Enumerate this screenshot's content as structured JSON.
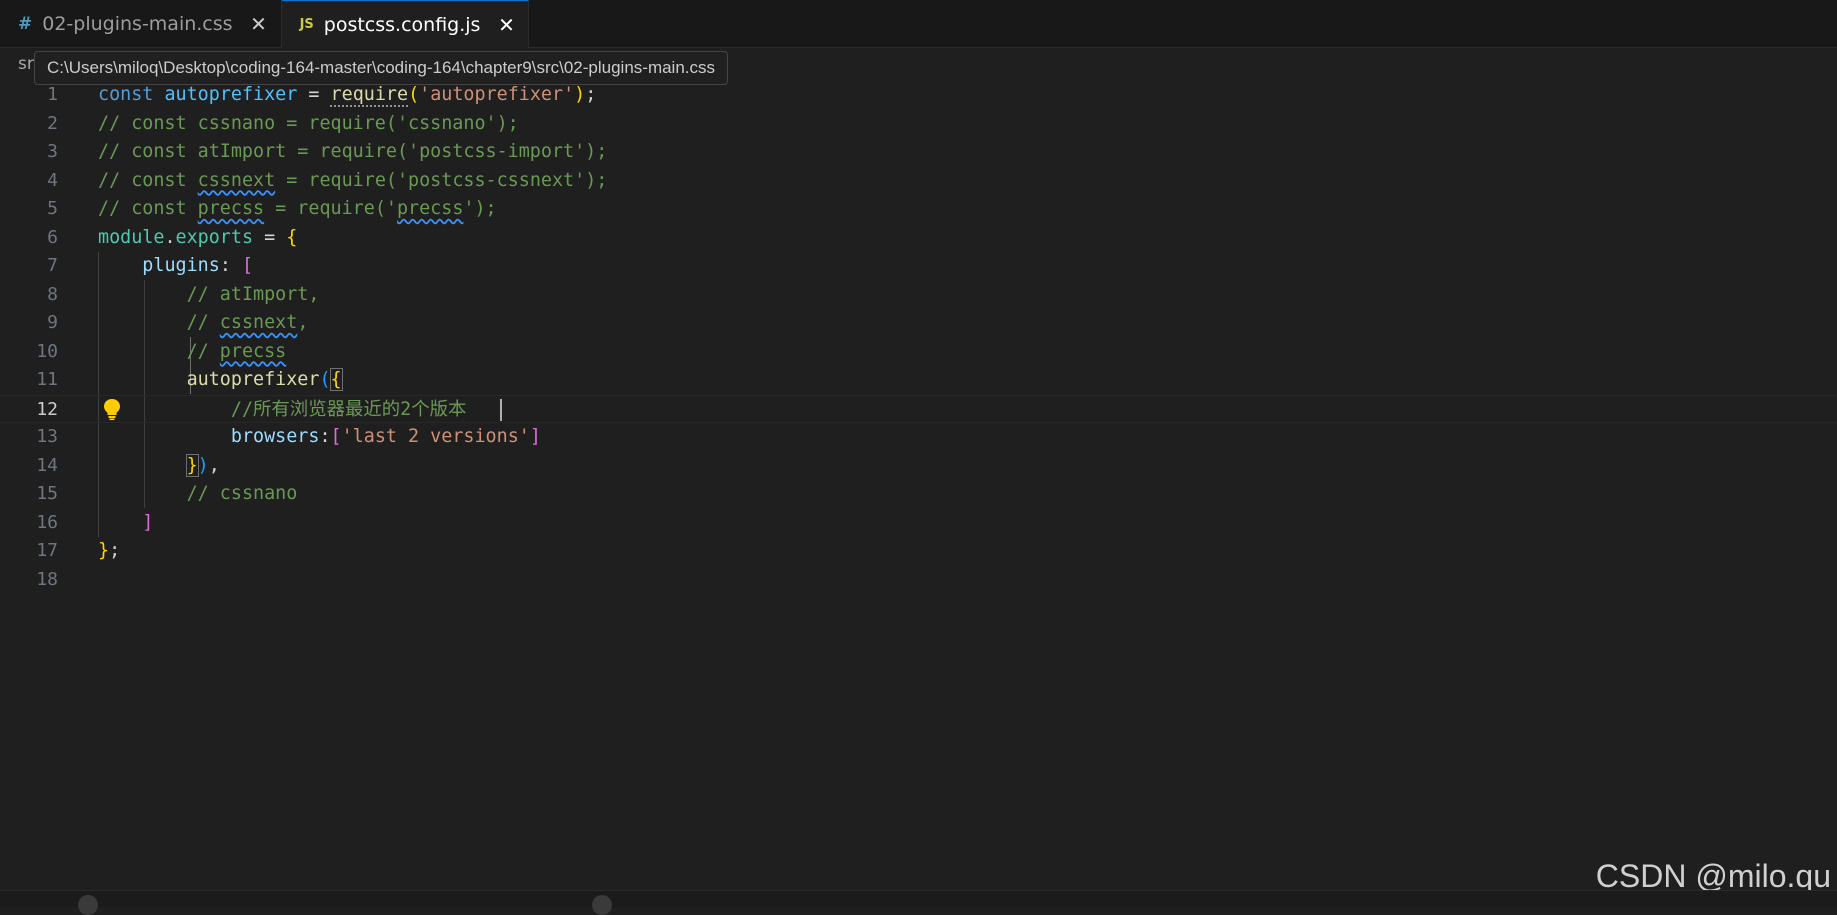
{
  "tabs": [
    {
      "icon": "#",
      "label": "02-plugins-main.css",
      "active": false
    },
    {
      "icon": "JS",
      "label": "postcss.config.js",
      "active": true
    }
  ],
  "breadcrumb": "sr",
  "tooltip": "C:\\Users\\miloq\\Desktop\\coding-164-master\\coding-164\\chapter9\\src\\02-plugins-main.css",
  "editor": {
    "current_line": 12,
    "line_numbers": [
      "1",
      "2",
      "3",
      "4",
      "5",
      "6",
      "7",
      "8",
      "9",
      "10",
      "11",
      "12",
      "13",
      "14",
      "15",
      "16",
      "17",
      "18"
    ]
  },
  "code": {
    "l1": {
      "kw": "const",
      "var": "autoprefixer",
      "eq": " = ",
      "fn": "require",
      "str": "'autoprefixer'",
      "end": ";"
    },
    "l2": "// const cssnano = require('cssnano');",
    "l3": "// const atImport = require('postcss-import');",
    "l4": {
      "a": "// const ",
      "b": "cssnext",
      "c": " = require('postcss-cssnext');"
    },
    "l5": {
      "a": "// const ",
      "b": "precss",
      "c": " = require('",
      "d": "precss",
      "e": "');"
    },
    "l6": {
      "mod": "module",
      "dot": ".",
      "exp": "exports",
      "eq": " = "
    },
    "l7": {
      "prop": "plugins",
      "colon": ": "
    },
    "l8": "// atImport,",
    "l9": {
      "a": "// ",
      "b": "cssnext",
      "c": ","
    },
    "l10": {
      "a": "// ",
      "b": "precss"
    },
    "l11": {
      "fn": "autoprefixer"
    },
    "l12": "//所有浏览器最近的2个版本",
    "l13": {
      "prop": "browsers",
      "colon": ":",
      "str": "'last 2 versions'"
    },
    "l14": {
      "comma": ","
    },
    "l15": "// cssnano",
    "l17": {
      "semi": ";"
    }
  },
  "colors": {
    "keyword": "#569cd6",
    "variable": "#4fc1ff",
    "function": "#dcdcaa",
    "string": "#ce9178",
    "comment": "#6a9955",
    "property": "#9cdcfe"
  },
  "icons": {
    "lightbulb": "lightbulb-icon",
    "close": "close-icon"
  },
  "watermark": "CSDN @milo.qu"
}
